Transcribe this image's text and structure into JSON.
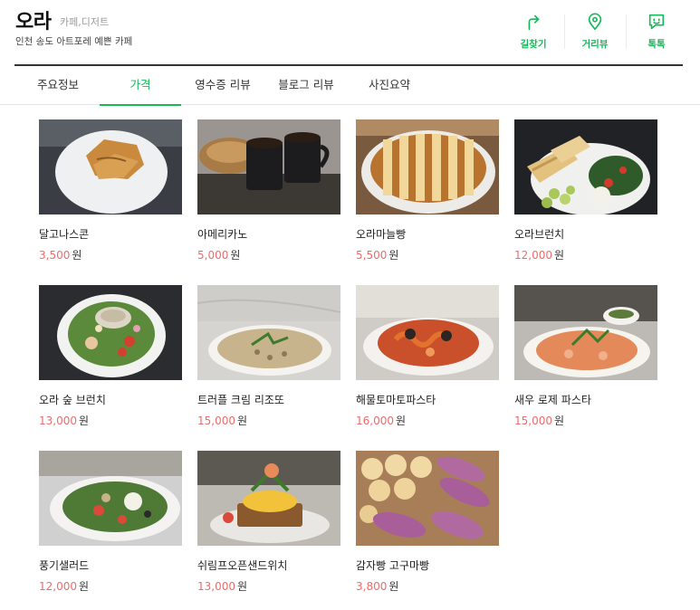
{
  "store": {
    "name": "오라",
    "category": "카페,디저트",
    "description": "인천 송도 아트포레 예쁜 카페"
  },
  "actions": [
    {
      "label": "길찾기",
      "icon": "directions-icon"
    },
    {
      "label": "거리뷰",
      "icon": "street-view-icon"
    },
    {
      "label": "톡톡",
      "icon": "talktalk-icon"
    }
  ],
  "tabs": [
    {
      "label": "주요정보",
      "active": false
    },
    {
      "label": "가격",
      "active": true
    },
    {
      "label": "영수증 리뷰",
      "active": false
    },
    {
      "label": "블로그 리뷰",
      "active": false
    },
    {
      "label": "사진요약",
      "active": false
    }
  ],
  "currency_unit": "원",
  "menu": [
    {
      "name": "달고나스콘",
      "price": "3,500"
    },
    {
      "name": "아메리카노",
      "price": "5,000"
    },
    {
      "name": "오라마늘빵",
      "price": "5,500"
    },
    {
      "name": "오라브런치",
      "price": "12,000"
    },
    {
      "name": "오라 숲 브런치",
      "price": "13,000"
    },
    {
      "name": "트러플 크림 리조또",
      "price": "15,000"
    },
    {
      "name": "해물토마토파스타",
      "price": "16,000"
    },
    {
      "name": "새우 로제 파스타",
      "price": "15,000"
    },
    {
      "name": "풍기샐러드",
      "price": "12,000"
    },
    {
      "name": "쉬림프오픈샌드위치",
      "price": "13,000"
    },
    {
      "name": "감자빵 고구마빵",
      "price": "3,800"
    }
  ],
  "colors": {
    "accent": "#17b85a",
    "price": "#ee6b6b"
  }
}
